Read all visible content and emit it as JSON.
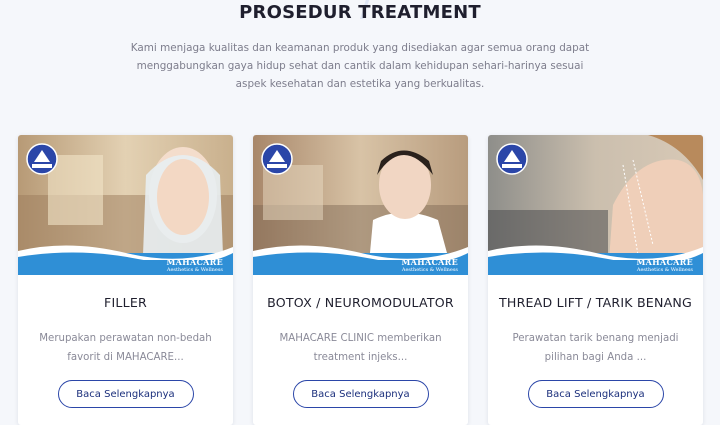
{
  "section": {
    "title": "PROSEDUR TREATMENT",
    "description": "Kami menjaga kualitas dan keamanan produk yang disediakan agar semua orang dapat menggabungkan gaya hidup sehat dan cantik dalam kehidupan sehari-harinya sesuai aspek kesehatan dan estetika yang berkualitas."
  },
  "brand": {
    "name": "MAHACARE",
    "tagline": "Aesthetics & Wellness",
    "logo_text": "MAHACARE",
    "colors": {
      "accent": "#2b46a8",
      "wave": "#2f8fd6",
      "text": "#1f1f2e"
    }
  },
  "cards": [
    {
      "title": "FILLER",
      "description": "Merupakan perawatan non-bedah favorit di MAHACARE...",
      "button": "Baca Selengkapnya"
    },
    {
      "title": "BOTOX / NEUROMODULATOR",
      "description": "MAHACARE CLINIC memberikan treatment injeks...",
      "button": "Baca Selengkapnya"
    },
    {
      "title": "THREAD LIFT / TARIK BENANG",
      "description": "Perawatan tarik benang menjadi pilihan bagi Anda ...",
      "button": "Baca Selengkapnya"
    }
  ]
}
